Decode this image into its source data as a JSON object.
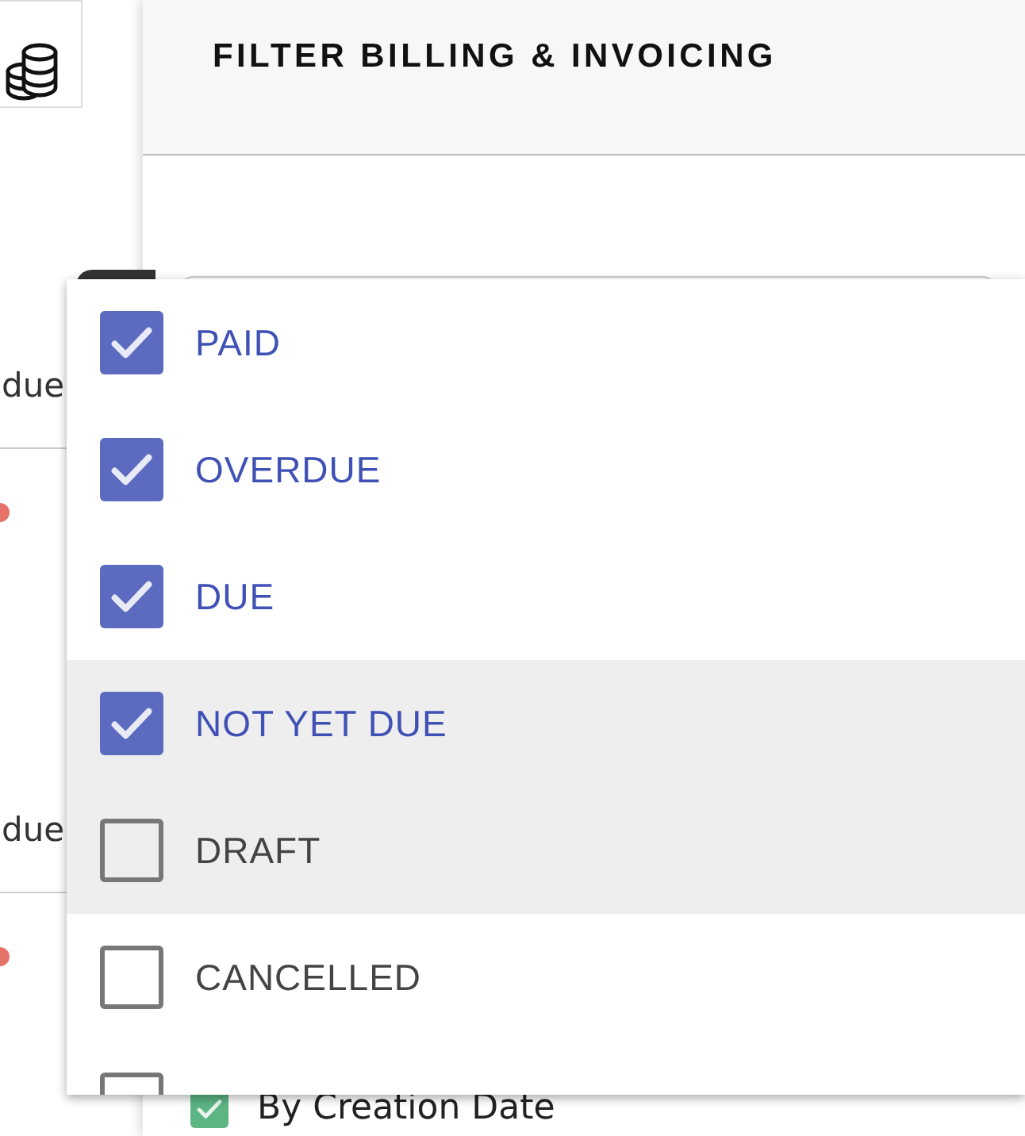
{
  "background_list": {
    "rows": [
      {
        "status": "due"
      },
      {
        "status": "due"
      }
    ]
  },
  "filter_panel": {
    "title": "FILTER BILLING & INVOICING",
    "date_option": {
      "label": "By Creation Date",
      "checked": true
    }
  },
  "status_dropdown": {
    "options": [
      {
        "label": "PAID",
        "checked": true,
        "highlighted": false
      },
      {
        "label": "OVERDUE",
        "checked": true,
        "highlighted": false
      },
      {
        "label": "DUE",
        "checked": true,
        "highlighted": false
      },
      {
        "label": "NOT YET DUE",
        "checked": true,
        "highlighted": true
      },
      {
        "label": "DRAFT",
        "checked": false,
        "highlighted": true
      },
      {
        "label": "CANCELLED",
        "checked": false,
        "highlighted": false
      },
      {
        "checked": false,
        "highlighted": false
      }
    ]
  }
}
